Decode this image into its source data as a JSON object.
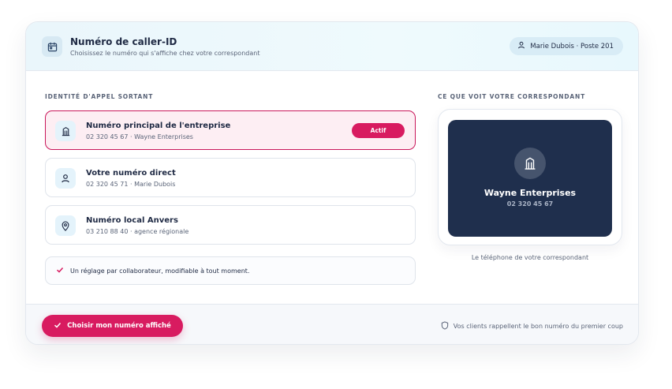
{
  "header": {
    "title": "Numéro de caller-ID",
    "subtitle": "Choisissez le numéro qui s'affiche chez votre correspondant",
    "icon": "calendar-icon",
    "user": "Marie Dubois · Poste 201"
  },
  "left": {
    "section_label": "IDENTITÉ D'APPEL SORTANT",
    "options": [
      {
        "title": "Numéro principal de l'entreprise",
        "subtitle": "02 320 45 67 · Wayne Enterprises",
        "icon": "building-icon",
        "badge": "Actif",
        "selected": true
      },
      {
        "title": "Votre numéro direct",
        "subtitle": "02 320 45 71 · Marie Dubois",
        "icon": "user-icon",
        "selected": false
      },
      {
        "title": "Numéro local Anvers",
        "subtitle": "03 210 88 40 · agence régionale",
        "icon": "location-pin-icon",
        "selected": false
      }
    ],
    "note": "Un réglage par collaborateur, modifiable à tout moment."
  },
  "right": {
    "section_label": "CE QUE VOIT VOTRE CORRESPONDANT",
    "preview_name": "Wayne Enterprises",
    "preview_number": "02 320 45 67",
    "caption": "Le téléphone de votre correspondant"
  },
  "footer": {
    "cta_label": "Choisir mon numéro affiché",
    "note": "Vos clients rappellent le bon numéro du premier coup"
  },
  "colors": {
    "accent": "#d81b60",
    "navy": "#1f2f4d",
    "header_bg": "#eaf6fb"
  }
}
